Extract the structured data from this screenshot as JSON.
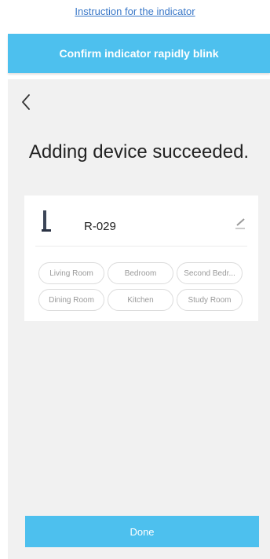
{
  "header": {
    "instruction_link": "Instruction for the indicator",
    "confirm_label": "Confirm indicator rapidly blink"
  },
  "page": {
    "back_icon": "chevron-left-icon",
    "title": "Adding device succeeded."
  },
  "device": {
    "icon": "device-tower-icon",
    "name": "R-029",
    "edit_icon": "pencil-icon"
  },
  "rooms": [
    "Living Room",
    "Bedroom",
    "Second Bedr...",
    "Dining Room",
    "Kitchen",
    "Study Room"
  ],
  "footer": {
    "done_label": "Done"
  },
  "colors": {
    "accent": "#4dc0ee",
    "link": "#3a78c8",
    "panel_bg": "#f1f1f1"
  }
}
